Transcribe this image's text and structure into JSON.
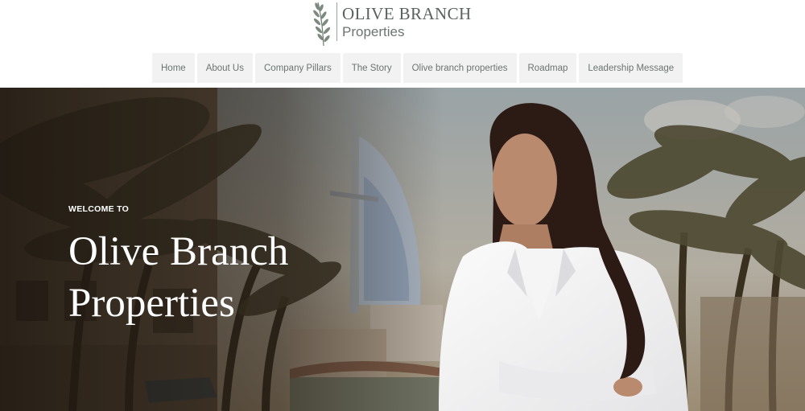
{
  "header": {
    "logo": {
      "icon": "olive-branch-icon",
      "line1": "OLIVE BRANCH",
      "line2": "Properties"
    },
    "nav": [
      {
        "label": "Home"
      },
      {
        "label": "About Us"
      },
      {
        "label": "Company Pillars"
      },
      {
        "label": "The Story"
      },
      {
        "label": "Olive branch properties"
      },
      {
        "label": "Roadmap"
      },
      {
        "label": "Leadership Message"
      }
    ]
  },
  "hero": {
    "eyebrow": "WELCOME TO",
    "title": "Olive Branch Properties"
  },
  "colors": {
    "nav_bg": "#f1f2f1",
    "nav_text": "#6c7370",
    "logo_text": "#5a615e",
    "hero_text": "#ffffff"
  }
}
